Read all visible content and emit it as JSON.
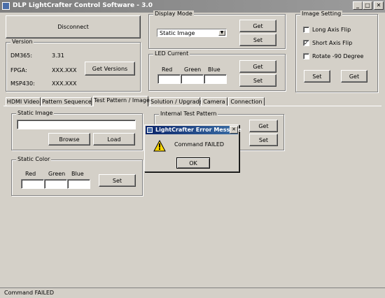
{
  "window": {
    "title": "DLP LightCrafter Control Software - 3.0",
    "minimize": "_",
    "maximize": "□",
    "close": "✕"
  },
  "connection": {
    "disconnect_label": "Disconnect"
  },
  "version": {
    "group_label": "Version",
    "rows": [
      {
        "label": "DM365:",
        "value": "3.31"
      },
      {
        "label": "FPGA:",
        "value": "XXX.XXX"
      },
      {
        "label": "MSP430:",
        "value": "XXX.XXX"
      }
    ],
    "get_versions_label": "Get Versions"
  },
  "display_mode": {
    "group_label": "Display Mode",
    "selected": "Static Image",
    "get_label": "Get",
    "set_label": "Set"
  },
  "led_current": {
    "group_label": "LED Current",
    "red_label": "Red",
    "green_label": "Green",
    "blue_label": "Blue",
    "red_value": "",
    "green_value": "",
    "blue_value": "",
    "get_label": "Get",
    "set_label": "Set"
  },
  "image_setting": {
    "group_label": "Image Setting",
    "options": [
      {
        "label": "Long Axis Flip",
        "checked": false,
        "mark": ""
      },
      {
        "label": "Short Axis Flip",
        "checked": true,
        "mark": "✓"
      },
      {
        "label": "Rotate -90 Degree",
        "checked": false,
        "mark": ""
      }
    ],
    "set_label": "Set",
    "get_label": "Get"
  },
  "tabs": [
    {
      "label": "HDMI Video"
    },
    {
      "label": "Pattern Sequence"
    },
    {
      "label": "Test Pattern / Image"
    },
    {
      "label": "Solution / Upgrade"
    },
    {
      "label": "Camera"
    },
    {
      "label": "Connection"
    }
  ],
  "static_image": {
    "group_label": "Static Image",
    "path_value": "",
    "browse_label": "Browse",
    "load_label": "Load"
  },
  "internal_test_pattern": {
    "group_label": "Internal Test Pattern",
    "get_label": "Get",
    "set_label": "Set"
  },
  "static_color": {
    "group_label": "Static Color",
    "red_label": "Red",
    "green_label": "Green",
    "blue_label": "Blue",
    "set_label": "Set"
  },
  "error_dialog": {
    "title": "LightCrafter Error Message",
    "close": "✕",
    "message": "Command FAILED",
    "ok_label": "OK"
  },
  "status_bar": {
    "text": "Command FAILED"
  }
}
